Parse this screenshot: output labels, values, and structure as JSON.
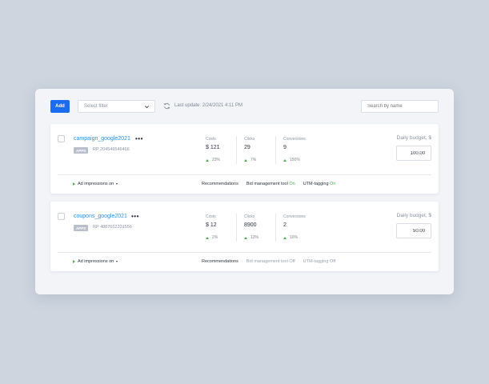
{
  "toolbar": {
    "add_label": "Add",
    "filter_placeholder": "Select filter",
    "last_update": "Last update: 2/24/2021 4:11 PM",
    "search_placeholder": "Search by name"
  },
  "campaigns": [
    {
      "name": "campaign_google2021",
      "badge": "APPS",
      "rp": "RP 204546546466",
      "metrics": [
        {
          "label": "Costs",
          "value": "$ 121",
          "delta": "23%"
        },
        {
          "label": "Clicks",
          "value": "29",
          "delta": "7%"
        },
        {
          "label": "Conversions",
          "value": "9",
          "delta": "150%"
        }
      ],
      "budget_label": "Daily budget, $",
      "budget_value": "100.00",
      "impressions": "Ad impressions on",
      "recommendations": "Recommendations",
      "bid_label": "Bid management tool",
      "bid_state": "On",
      "utm_label": "UTM-tagging",
      "utm_state": "On"
    },
    {
      "name": "coupons_google2021",
      "badge": "APPS",
      "rp": "RP 4887652201556",
      "metrics": [
        {
          "label": "Costs",
          "value": "$ 12",
          "delta": "2%"
        },
        {
          "label": "Clicks",
          "value": "8900",
          "delta": "13%"
        },
        {
          "label": "Conversions",
          "value": "2",
          "delta": "10%"
        }
      ],
      "budget_label": "Daily budget, $",
      "budget_value": "50.00",
      "impressions": "Ad impressions on",
      "recommendations": "Recommendations",
      "bid_label": "Bid management tool",
      "bid_state": "Off",
      "utm_label": "UTM-tagging",
      "utm_state": "Off"
    }
  ],
  "colors": {
    "accent": "#1a6cf0",
    "link": "#2a8fd9",
    "positive": "#4caf50",
    "background": "#ced5df"
  }
}
